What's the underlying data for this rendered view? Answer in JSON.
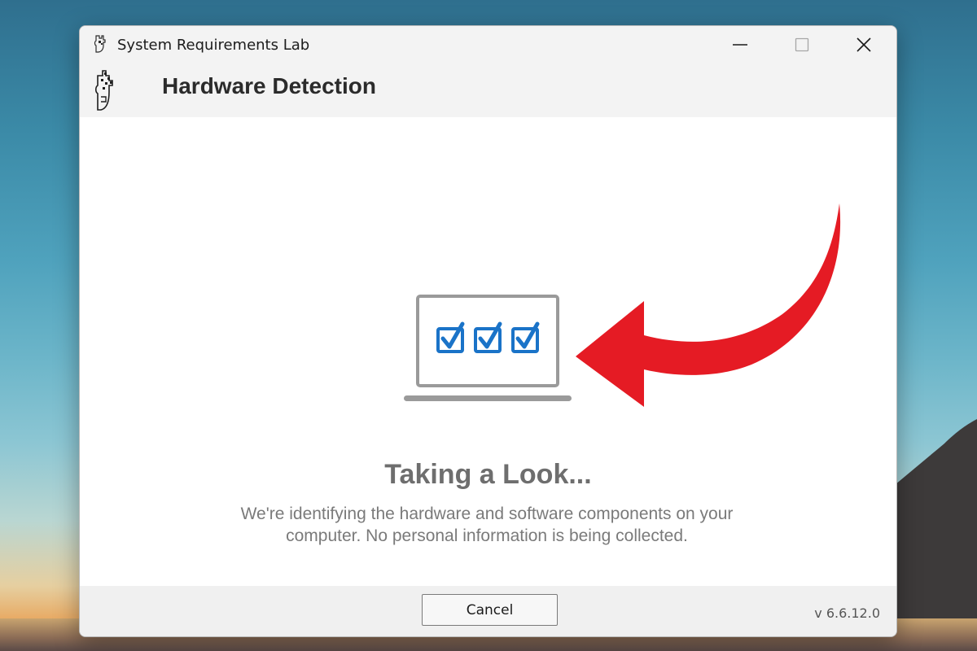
{
  "window": {
    "title": "System Requirements Lab",
    "controls": {
      "minimize_icon": "minimize-icon",
      "maximize_icon": "maximize-icon",
      "close_icon": "close-icon"
    }
  },
  "header": {
    "title": "Hardware Detection",
    "brand_icon": "srl-logo-icon"
  },
  "main": {
    "illustration_icon": "laptop-checklist-icon",
    "arrow_icon": "red-curved-arrow-icon",
    "heading": "Taking a Look...",
    "description": "We're identifying the hardware and software components on your computer. No personal information is being collected."
  },
  "footer": {
    "cancel_label": "Cancel",
    "version": "v 6.6.12.0"
  },
  "colors": {
    "accent_blue": "#1a73c8",
    "arrow_red": "#e51b24",
    "laptop_gray": "#9a9a9a"
  }
}
